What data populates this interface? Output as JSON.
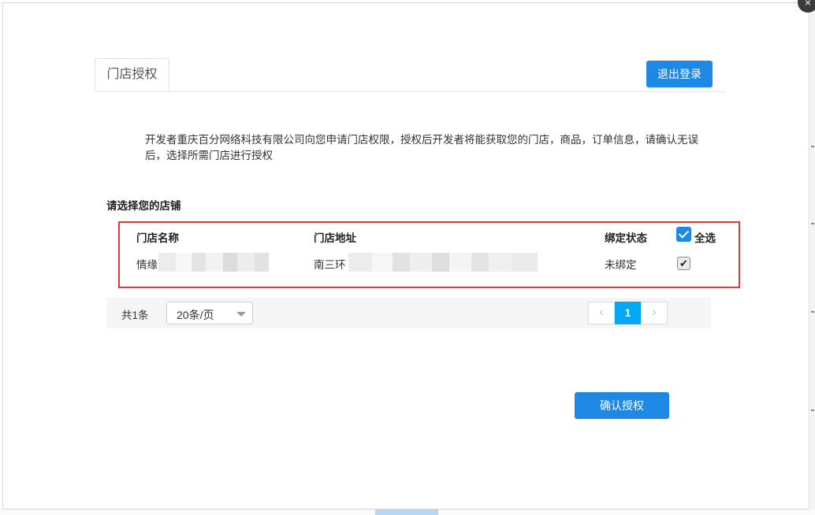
{
  "dialog": {
    "close_glyph": "×",
    "tab_label": "门店授权",
    "logout_label": "退出登录",
    "notice": "开发者重庆百分网络科技有限公司向您申请门店权限，授权后开发者将能获取您的门店，商品，订单信息，请确认无误后，选择所需门店进行授权",
    "section_title": "请选择您的店铺",
    "confirm_label": "确认授权"
  },
  "store_table": {
    "headers": {
      "name": "门店名称",
      "address": "门店地址",
      "status": "绑定状态",
      "select_all": "全选"
    },
    "select_all_checked": true,
    "rows": [
      {
        "name_visible": "情缘",
        "address_visible": "南三环",
        "status": "未绑定",
        "checked": true,
        "check_glyph": "✔"
      }
    ]
  },
  "pagination": {
    "total": "共1条",
    "page_size": "20条/页",
    "prev_glyph": "‹",
    "next_glyph": "›",
    "current_page": "1"
  },
  "colors": {
    "primary": "#1e88e5",
    "page_active": "#03a9f4",
    "highlight_border": "#e53935"
  }
}
